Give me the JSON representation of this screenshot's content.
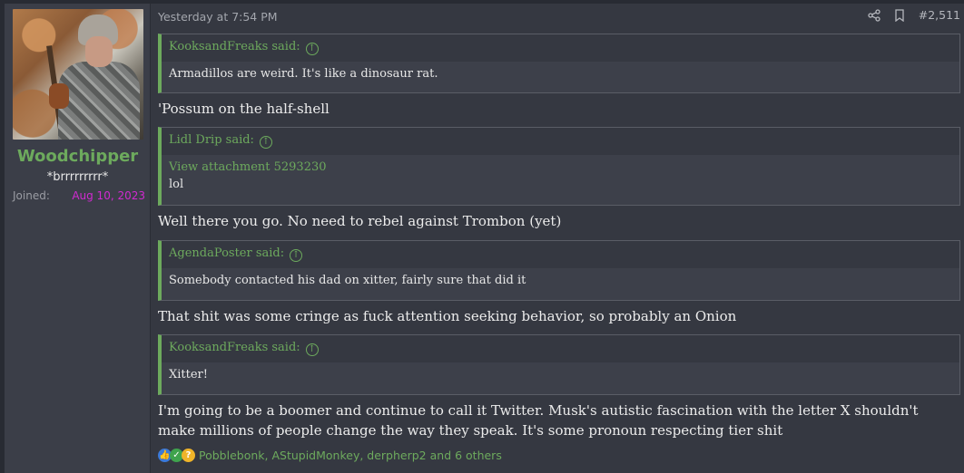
{
  "user": {
    "name": "Woodchipper",
    "title": "*brrrrrrrrr*",
    "joined_label": "Joined:",
    "joined_value": "Aug 10, 2023"
  },
  "meta": {
    "timestamp": "Yesterday at 7:54 PM",
    "post_number": "#2,511",
    "share_icon": "share-icon",
    "bookmark_icon": "bookmark-icon"
  },
  "quotes": [
    {
      "author": "KooksandFreaks said:",
      "attachment": "",
      "text": "Armadillos are weird. It's like a dinosaur rat."
    },
    {
      "author": "Lidl Drip said:",
      "attachment": "View attachment 5293230",
      "text": "lol"
    },
    {
      "author": "AgendaPoster said:",
      "attachment": "",
      "text": "Somebody contacted his dad on xitter, fairly sure that did it"
    },
    {
      "author": "KooksandFreaks said:",
      "attachment": "",
      "text": "Xitter!"
    }
  ],
  "replies": [
    "'Possum on the half-shell",
    "Well there you go. No need to rebel against Trombon (yet)",
    "That shit was some cringe as fuck attention seeking behavior, so probably an Onion",
    "I'm going to be a boomer and continue to call it Twitter. Musk's autistic fascination with the letter X shouldn't make millions of people change the way they speak. It's some pronoun respecting tier shit"
  ],
  "reactions": {
    "text": "Pobblebonk, AStupidMonkey, derpherp2 and 6 others",
    "icons": [
      "like-icon",
      "check-icon",
      "thinking-icon"
    ]
  },
  "colors": {
    "accent_green": "#6daa5d",
    "joined_pink": "#d12ad1"
  }
}
